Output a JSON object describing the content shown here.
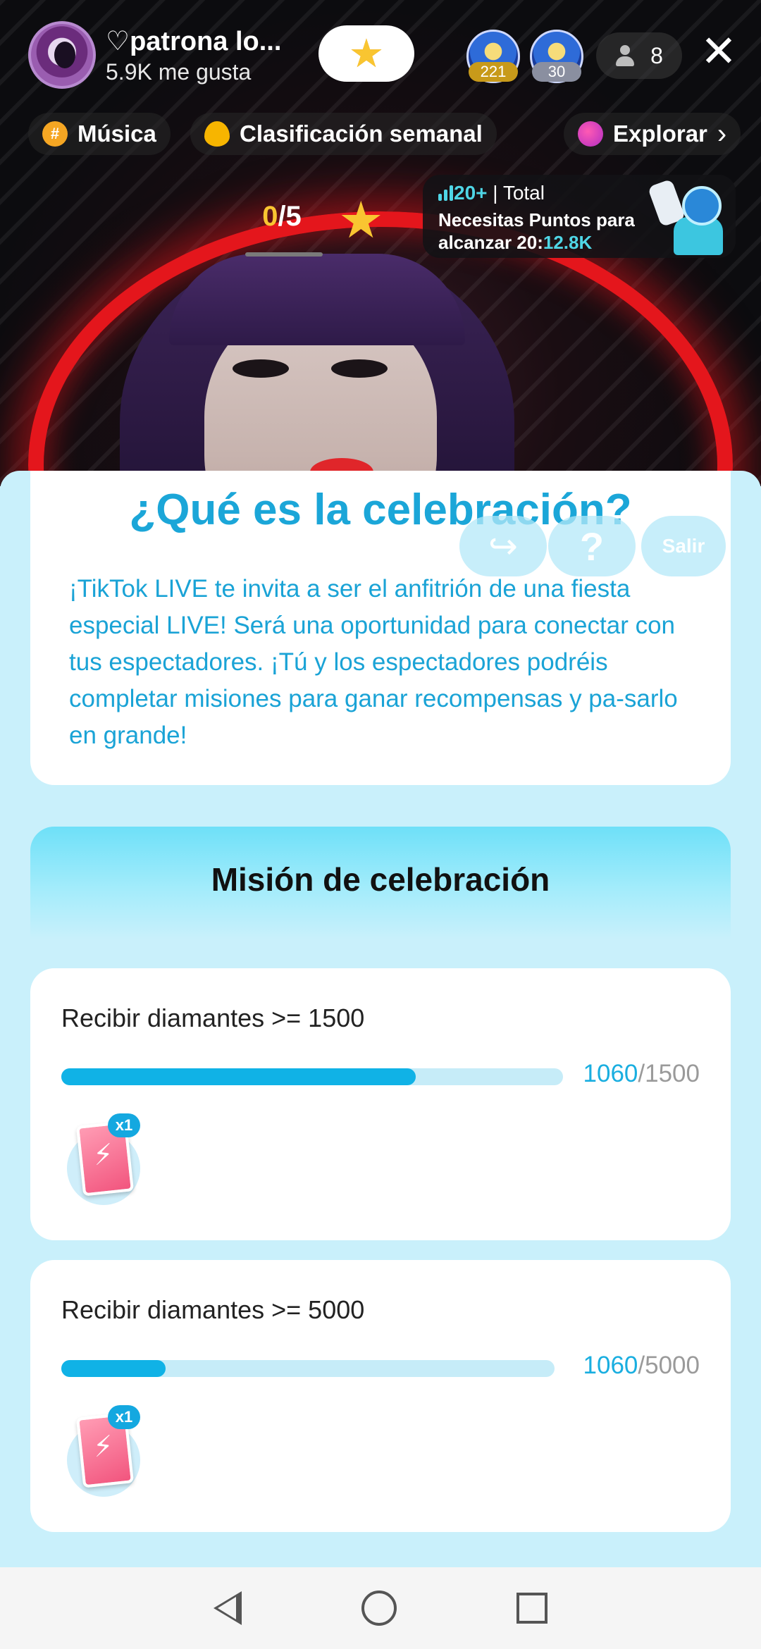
{
  "live": {
    "host_name": "♡patrona lo...",
    "host_likes": "5.9K me gusta",
    "viewers": [
      {
        "badge": "221"
      },
      {
        "badge": "30"
      }
    ],
    "viewer_count": "8",
    "close_label": "✕"
  },
  "categories": [
    {
      "label": "Música",
      "icon": "hashtag-icon"
    },
    {
      "label": "Clasificación semanal",
      "icon": "flame-icon"
    },
    {
      "label": "Explorar",
      "icon": "planet-icon"
    }
  ],
  "progress": {
    "current": "0",
    "total": "/5"
  },
  "rank": {
    "level": "20+",
    "scope": "| Total",
    "line": "Necesitas Puntos para alcanzar 20:",
    "points": "12.8K"
  },
  "sheet": {
    "intro_title": "¿Qué es la celebración?",
    "intro_body": "¡TikTok LIVE te invita a ser el anfitrión de una fiesta especial LIVE! Será una oportunidad para conectar con tus espectadores. ¡Tú y los espectadores podréis completar misiones para ganar recompensas y pa-sarlo en grande!",
    "share_icon": "↪",
    "help_label": "?",
    "exit_label": "Salir",
    "mission_title": "Misión de celebración",
    "missions": [
      {
        "label": "Recibir diamantes >= 1500",
        "done": "1060",
        "goal": "/1500",
        "progress": 0.707,
        "reward_qty": "x1"
      },
      {
        "label": "Recibir diamantes >= 5000",
        "done": "1060",
        "goal": "/5000",
        "progress": 0.212,
        "reward_qty": "x1"
      }
    ]
  },
  "colors": {
    "accent": "#1ba6d8",
    "progress_fill": "#10b2e6",
    "gold": "#f9c531"
  }
}
